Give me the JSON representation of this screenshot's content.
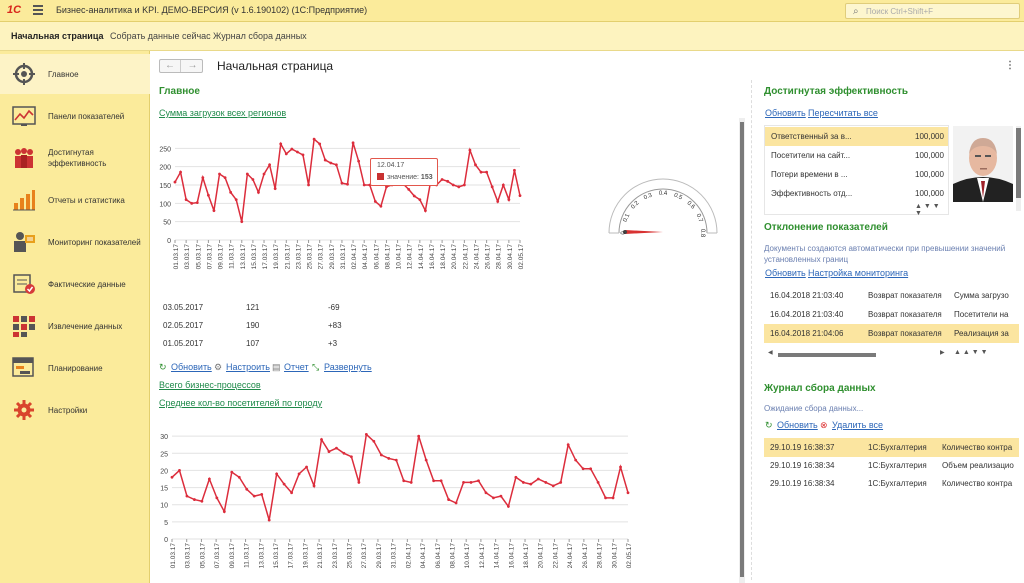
{
  "titlebar": {
    "logo": "1С",
    "title": "Бизнес-аналитика и KPI. ДЕМО-ВЕРСИЯ (v 1.6.190102)  (1С:Предприятие)",
    "search_placeholder": "Поиск Ctrl+Shift+F"
  },
  "sections": [
    "Начальная страница",
    "Собрать данные сейчас",
    "Журнал сбора данных"
  ],
  "sidebar": {
    "items": [
      {
        "label": "Главное",
        "icon": "crosshair-icon"
      },
      {
        "label": "Панели показателей",
        "icon": "dashboard-chart-icon"
      },
      {
        "label": "Достигнутая эффективность",
        "icon": "people-icon"
      },
      {
        "label": "Отчеты и статистика",
        "icon": "bar-chart-icon"
      },
      {
        "label": "Мониторинг показателей",
        "icon": "monitoring-icon"
      },
      {
        "label": "Фактические данные",
        "icon": "data-check-icon"
      },
      {
        "label": "Извлечение данных",
        "icon": "grid-blocks-icon"
      },
      {
        "label": "Планирование",
        "icon": "planning-icon"
      },
      {
        "label": "Настройки",
        "icon": "gear-icon"
      }
    ]
  },
  "main": {
    "page_title": "Начальная страница",
    "section_title": "Главное",
    "chart1_link": "Сумма загрузок всех регионов",
    "rows": [
      {
        "date": "03.05.2017",
        "value": "121",
        "diff": "-69"
      },
      {
        "date": "02.05.2017",
        "value": "190",
        "diff": "+83"
      },
      {
        "date": "01.05.2017",
        "value": "107",
        "diff": "+3"
      }
    ],
    "actions": [
      "Обновить",
      "Настроить",
      "Отчет",
      "Развернуть"
    ],
    "link_processes": "Всего бизнес-процессов",
    "chart2_link": "Среднее кол-во посетителей по городу",
    "tooltip": {
      "date": "12.04.17",
      "label": "значение:",
      "value": "153"
    },
    "gauge_ticks": [
      "0",
      "0.1",
      "0.2",
      "0.3",
      "0.4",
      "0.5",
      "0.6",
      "0.7",
      "0.8"
    ]
  },
  "right": {
    "efficiency": {
      "title": "Достигнутая эффективность",
      "links": [
        "Обновить",
        "Пересчитать все"
      ],
      "rows": [
        {
          "name": "Ответственный за в...",
          "value": "100,000"
        },
        {
          "name": "Посетители на сайт...",
          "value": "100,000"
        },
        {
          "name": "Потери времени в ...",
          "value": "100,000"
        },
        {
          "name": "Эффективность отд...",
          "value": "100,000"
        }
      ]
    },
    "deviation": {
      "title": "Отклонение показателей",
      "description": "Документы создаются автоматически при превышении значений установленных границ",
      "links": [
        "Обновить",
        "Настройка мониторинга"
      ],
      "rows": [
        {
          "date": "16.04.2018 21:03:40",
          "type": "Возврат показателя",
          "subject": "Сумма загрузо"
        },
        {
          "date": "16.04.2018 21:03:40",
          "type": "Возврат показателя",
          "subject": "Посетители на"
        },
        {
          "date": "16.04.2018 21:04:06",
          "type": "Возврат показателя",
          "subject": "Реализация за"
        }
      ]
    },
    "journal": {
      "title": "Журнал сбора данных",
      "status": "Ожидание сбора данных...",
      "links": [
        "Обновить",
        "Удалить все"
      ],
      "rows": [
        {
          "date": "29.10.19 16:38:37",
          "source": "1С:Бухгалтерия",
          "item": "Количество контра"
        },
        {
          "date": "29.10.19 16:38:34",
          "source": "1С:Бухгалтерия",
          "item": "Объем реализацио"
        },
        {
          "date": "29.10.19 16:38:34",
          "source": "1С:Бухгалтерия",
          "item": "Количество контра"
        }
      ]
    }
  },
  "chart_data": [
    {
      "type": "line",
      "title": "Сумма загрузок всех регионов",
      "x_ticks": [
        "01.03.17",
        "03.03.17",
        "05.03.17",
        "07.03.17",
        "09.03.17",
        "11.03.17",
        "13.03.17",
        "15.03.17",
        "17.03.17",
        "19.03.17",
        "21.03.17",
        "23.03.17",
        "25.03.17",
        "27.03.17",
        "29.03.17",
        "31.03.17",
        "02.04.17",
        "04.04.17",
        "06.04.17",
        "08.04.17",
        "10.04.17",
        "12.04.17",
        "14.04.17",
        "16.04.17",
        "18.04.17",
        "20.04.17",
        "22.04.17",
        "24.04.17",
        "26.04.17",
        "28.04.17",
        "30.04.17",
        "02.05.17"
      ],
      "y_ticks": [
        0,
        50,
        100,
        150,
        200,
        250
      ],
      "ylim": [
        0,
        300
      ],
      "color": "#dc2d3c",
      "series": [
        {
          "values": [
            158,
            185,
            110,
            100,
            102,
            170,
            122,
            80,
            180,
            170,
            130,
            110,
            50,
            180,
            165,
            130,
            180,
            205,
            140,
            262,
            235,
            248,
            240,
            232,
            150,
            275,
            262,
            218,
            210,
            205,
            155,
            152,
            265,
            215,
            150,
            150,
            105,
            92,
            145,
            150,
            160,
            153,
            138,
            120,
            110,
            80,
            165,
            150,
            165,
            160,
            150,
            145,
            150,
            245,
            205,
            185,
            185,
            145,
            105,
            150,
            110,
            190,
            121
          ]
        }
      ]
    },
    {
      "type": "line",
      "title": "Среднее кол-во посетителей по городу",
      "x_ticks": [
        "01.03.17",
        "03.03.17",
        "05.03.17",
        "07.03.17",
        "09.03.17",
        "11.03.17",
        "13.03.17",
        "15.03.17",
        "17.03.17",
        "19.03.17",
        "21.03.17",
        "23.03.17",
        "25.03.17",
        "27.03.17",
        "29.03.17",
        "31.03.17",
        "02.04.17",
        "04.04.17",
        "06.04.17",
        "08.04.17",
        "10.04.17",
        "12.04.17",
        "14.04.17",
        "16.04.17",
        "18.04.17",
        "20.04.17",
        "22.04.17",
        "24.04.17",
        "26.04.17",
        "28.04.17",
        "30.04.17",
        "02.05.17"
      ],
      "y_ticks": [
        0,
        5,
        10,
        15,
        20,
        25,
        30
      ],
      "ylim": [
        0,
        35
      ],
      "color": "#dc2d3c",
      "series": [
        {
          "values": [
            18,
            20,
            12.5,
            11.5,
            11,
            17.5,
            12,
            8,
            19.5,
            18,
            14.5,
            12.5,
            13,
            5.5,
            19,
            16,
            13.5,
            19,
            21,
            15.5,
            29,
            25.5,
            26.5,
            25,
            24,
            16.5,
            30.5,
            28.5,
            24.5,
            23.5,
            23,
            17,
            16.5,
            30,
            23,
            17,
            17,
            11.5,
            10.5,
            16.5,
            16.5,
            17,
            13.5,
            12,
            12.5,
            9.5,
            18,
            16.5,
            16,
            17.5,
            16.5,
            15.5,
            16.5,
            27.5,
            23,
            20.5,
            20.5,
            16.5,
            12,
            12,
            21,
            13.5
          ]
        }
      ]
    }
  ]
}
